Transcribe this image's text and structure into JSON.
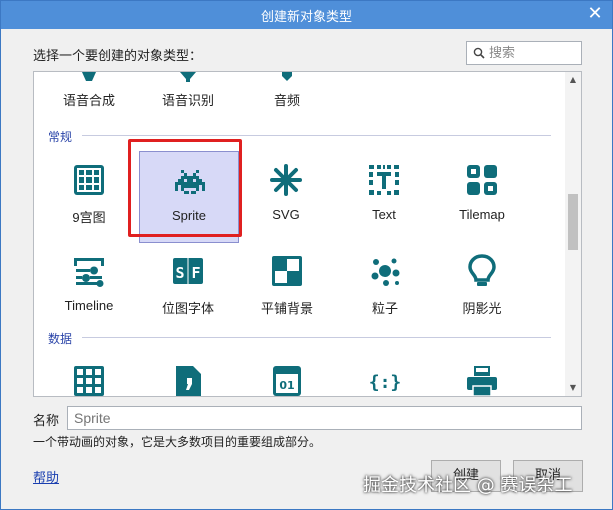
{
  "dialog": {
    "title": "创建新对象类型",
    "close_label": "✕"
  },
  "prompt": "选择一个要创建的对象类型：",
  "search": {
    "placeholder": "搜索",
    "icon": "search-icon"
  },
  "top_row": [
    {
      "label": "语音合成",
      "icon": "speech-synthesis-icon"
    },
    {
      "label": "语音识别",
      "icon": "speech-recognition-icon"
    },
    {
      "label": "音频",
      "icon": "audio-icon"
    }
  ],
  "categories": [
    {
      "title": "常规",
      "items": [
        {
          "label": "9宫图",
          "icon": "nine-patch-icon"
        },
        {
          "label": "Sprite",
          "icon": "sprite-invader-icon",
          "selected": true
        },
        {
          "label": "SVG",
          "icon": "svg-asterisk-icon"
        },
        {
          "label": "Text",
          "icon": "text-icon"
        },
        {
          "label": "Tilemap",
          "icon": "tilemap-icon"
        },
        {
          "label": "Timeline",
          "icon": "timeline-icon"
        },
        {
          "label": "位图字体",
          "icon": "bitmap-font-icon"
        },
        {
          "label": "平铺背景",
          "icon": "tiled-background-icon"
        },
        {
          "label": "粒子",
          "icon": "particles-icon"
        },
        {
          "label": "阴影光",
          "icon": "shadow-light-icon"
        }
      ]
    },
    {
      "title": "数据",
      "items": [
        {
          "label": "",
          "icon": "grid-table-icon"
        },
        {
          "label": "",
          "icon": "document-icon"
        },
        {
          "label": "",
          "icon": "local-storage-icon"
        },
        {
          "label": "",
          "icon": "json-icon",
          "glyph": "{:}"
        },
        {
          "label": "",
          "icon": "printer-icon"
        }
      ]
    }
  ],
  "name_field": {
    "label": "名称",
    "placeholder": "Sprite"
  },
  "description": "一个带动画的对象，它是大多数项目的重要组成部分。",
  "help_label": "帮助",
  "buttons": {
    "create": "创建",
    "cancel": "取消"
  },
  "watermark": "掘金技术社区 @ 赛误杂工",
  "colors": {
    "accent": "#4f8fd9",
    "icon": "#0f6d7a",
    "selection": "#d7d9f7",
    "highlight": "#e02020"
  }
}
